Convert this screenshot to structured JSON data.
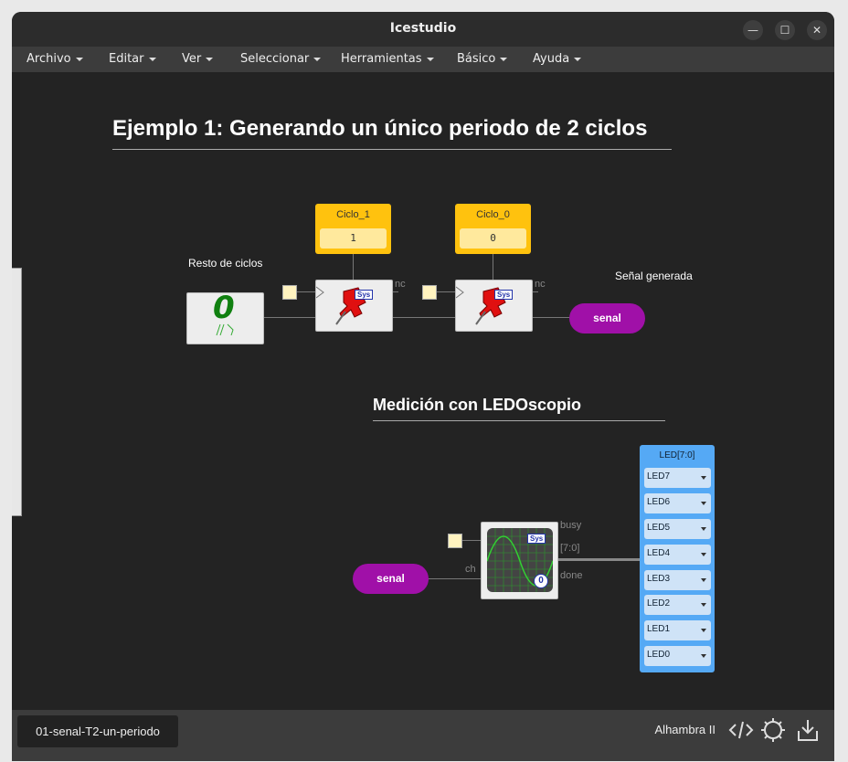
{
  "window": {
    "title": "Icestudio"
  },
  "menu": [
    "Archivo",
    "Editar",
    "Ver",
    "Seleccionar",
    "Herramientas",
    "Básico",
    "Ayuda"
  ],
  "canvas": {
    "heading1": "Ejemplo 1: Generando un único periodo de 2 ciclos",
    "heading2": "Medición con LEDOscopio",
    "label_resto": "Resto de ciclos",
    "label_senal_generada": "Señal generada",
    "const1": {
      "name": "Ciclo_1",
      "value": "1"
    },
    "const0": {
      "name": "Ciclo_0",
      "value": "0"
    },
    "zero_glyph": "0",
    "port_nc": "nc",
    "sys_badge": "Sys",
    "senal_out": "senal",
    "senal_in": "senal",
    "scope": {
      "port_ch": "ch",
      "port_busy": "busy",
      "port_bus": "[7:0]",
      "port_done": "done",
      "counter": "0"
    },
    "led_panel": {
      "title": "LED[7:0]",
      "leds": [
        "LED7",
        "LED6",
        "LED5",
        "LED4",
        "LED3",
        "LED2",
        "LED1",
        "LED0"
      ]
    }
  },
  "bottom": {
    "file_tab": "01-senal-T2-un-periodo",
    "board": "Alhambra II"
  },
  "colors": {
    "accent_const": "#ffc20e",
    "accent_pill": "#a010a8",
    "accent_led": "#55a9f5"
  }
}
